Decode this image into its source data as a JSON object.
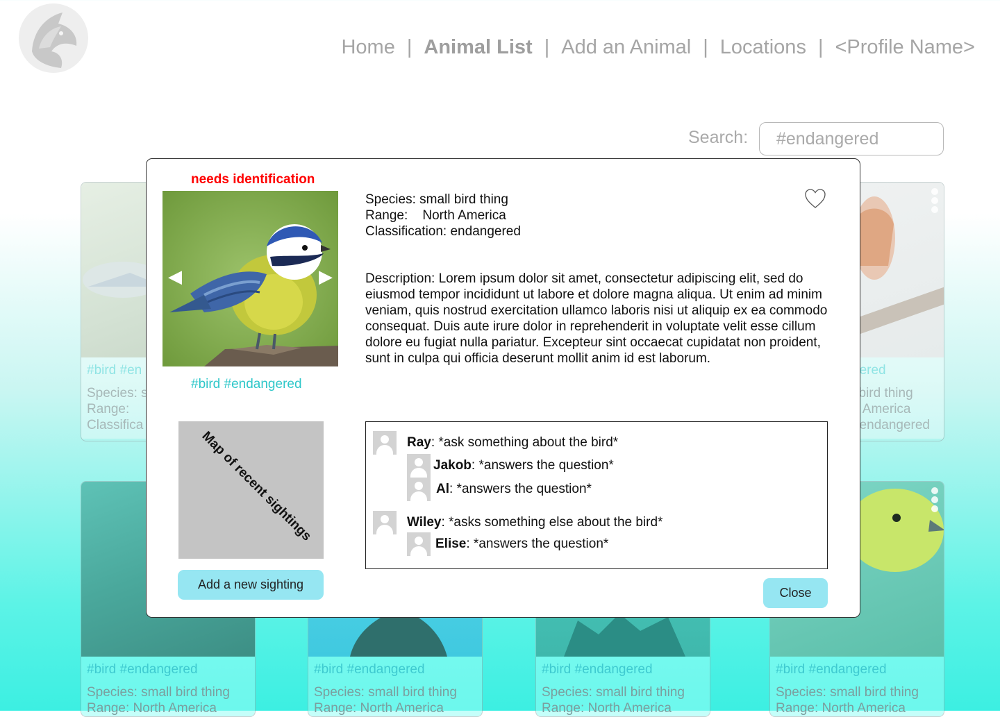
{
  "nav": {
    "items": [
      {
        "label": "Home",
        "active": false
      },
      {
        "label": "Animal List",
        "active": true
      },
      {
        "label": "Add an Animal",
        "active": false
      },
      {
        "label": "Locations",
        "active": false
      },
      {
        "label": "<Profile Name>",
        "active": false
      }
    ],
    "separator": "|"
  },
  "search": {
    "label": "Search:",
    "placeholder": "#endangered"
  },
  "cards_top": [
    {
      "tags": "#bird #en",
      "species": "Species: s",
      "range": "Range:",
      "classification": "Classifica"
    },
    {
      "tags": "gered",
      "species": "l bird thing",
      "range": "h America",
      "classification": ": endangered"
    }
  ],
  "cards_bottom": [
    {
      "tags": "#bird #endangered",
      "species": "Species: small bird thing",
      "range": "Range:    North America"
    },
    {
      "tags": "#bird #endangered",
      "species": "Species: small bird thing",
      "range": "Range:    North America"
    },
    {
      "tags": "#bird #endangered",
      "species": "Species: small bird thing",
      "range": "Range:    North America"
    },
    {
      "tags": "#bird #endangered",
      "species": "Species: small bird thing",
      "range": "Range:    North America"
    }
  ],
  "modal": {
    "flag": "needs identification",
    "tags": "#bird #endangered",
    "species": "Species: small bird thing",
    "range": "Range:    North America",
    "classification": "Classification: endangered",
    "description": "Description: Lorem ipsum dolor sit amet, consectetur adipiscing elit, sed do eiusmod tempor incididunt ut labore et dolore magna aliqua. Ut enim ad minim veniam, quis nostrud exercitation ullamco laboris nisi ut aliquip ex ea commodo consequat. Duis aute irure dolor in reprehenderit in voluptate velit esse cillum dolore eu fugiat nulla pariatur. Excepteur sint occaecat cupidatat non proident, sunt in culpa qui officia deserunt mollit anim id est laborum.",
    "map_label": "Map of recent sightings",
    "add_sighting": "Add a new sighting",
    "close": "Close",
    "prev_arrow": "◀",
    "next_arrow": "▶",
    "comments": [
      {
        "user": "Ray",
        "text": ": *ask something about the bird*"
      },
      {
        "user": "Jakob",
        "text": ": *answers the question*"
      },
      {
        "user": "Al",
        "text": ": *answers the question*"
      },
      {
        "user": "Wiley",
        "text": ": *asks something else about the bird*"
      },
      {
        "user": "Elise",
        "text": ": *answers the question*"
      }
    ]
  },
  "colors": {
    "accent": "#96e6f2",
    "tag": "#2ec7c9",
    "flag": "#ff0000",
    "nav": "#a5a5a5"
  }
}
